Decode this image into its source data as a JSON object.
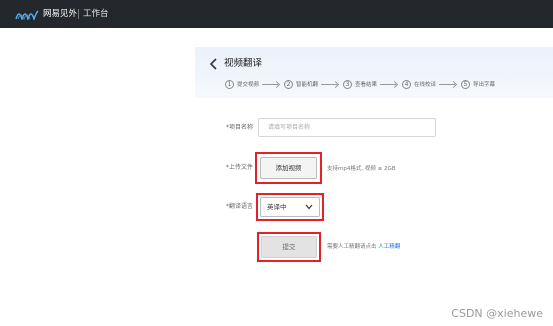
{
  "header": {
    "brand": "网易见外",
    "workspace": "工作台"
  },
  "page": {
    "title": "视频翻译"
  },
  "steps": [
    {
      "num": "1",
      "label": "提交视频"
    },
    {
      "num": "2",
      "label": "智能机翻"
    },
    {
      "num": "3",
      "label": "查看结果"
    },
    {
      "num": "4",
      "label": "在线校译"
    },
    {
      "num": "5",
      "label": "导出字幕"
    }
  ],
  "form": {
    "project_name": {
      "label": "*项目名称",
      "placeholder": "请填写项目名称"
    },
    "upload": {
      "label": "*上传文件",
      "button": "添加视频",
      "hint": "支持mp4格式, 视频 ≤ 2GB"
    },
    "language": {
      "label": "*翻译语言",
      "value": "英译中"
    },
    "submit": {
      "button": "提交",
      "hint_text": "需要人工精翻请点击",
      "hint_link": "人工精翻"
    }
  },
  "watermark": "CSDN @xiehewe",
  "colors": {
    "topbar": "#24272c",
    "highlight": "#e0232b",
    "link": "#1f7ae0",
    "logo": "#5ab0f0"
  }
}
